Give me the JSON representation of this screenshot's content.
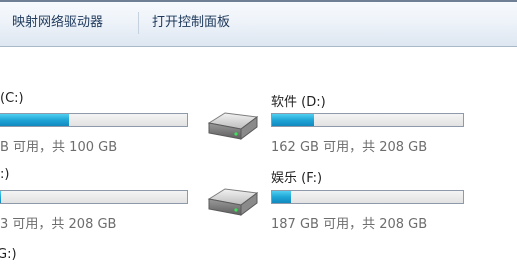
{
  "toolbar": {
    "map_network_drive": "映射网络驱动器",
    "open_control_panel": "打开控制面板"
  },
  "drives": {
    "c": {
      "label": "(C:)",
      "info": "B 可用，共 100 GB",
      "used_fraction": 0.37
    },
    "d": {
      "label": "软件 (D:)",
      "info": "162 GB 可用，共 208 GB",
      "used_fraction": 0.22
    },
    "e": {
      "label": ":)",
      "info": "3 可用，共 208 GB",
      "used_fraction": 0.01
    },
    "f": {
      "label": "娱乐 (F:)",
      "info": "187 GB 可用，共 208 GB",
      "used_fraction": 0.1
    },
    "g": {
      "label": "G:)"
    }
  },
  "colors": {
    "bar_fill": "#1fa5d6",
    "toolbar_text": "#1e395b",
    "info_text": "#6d6d6d"
  },
  "icons": {
    "drive": "hard-drive-icon"
  }
}
